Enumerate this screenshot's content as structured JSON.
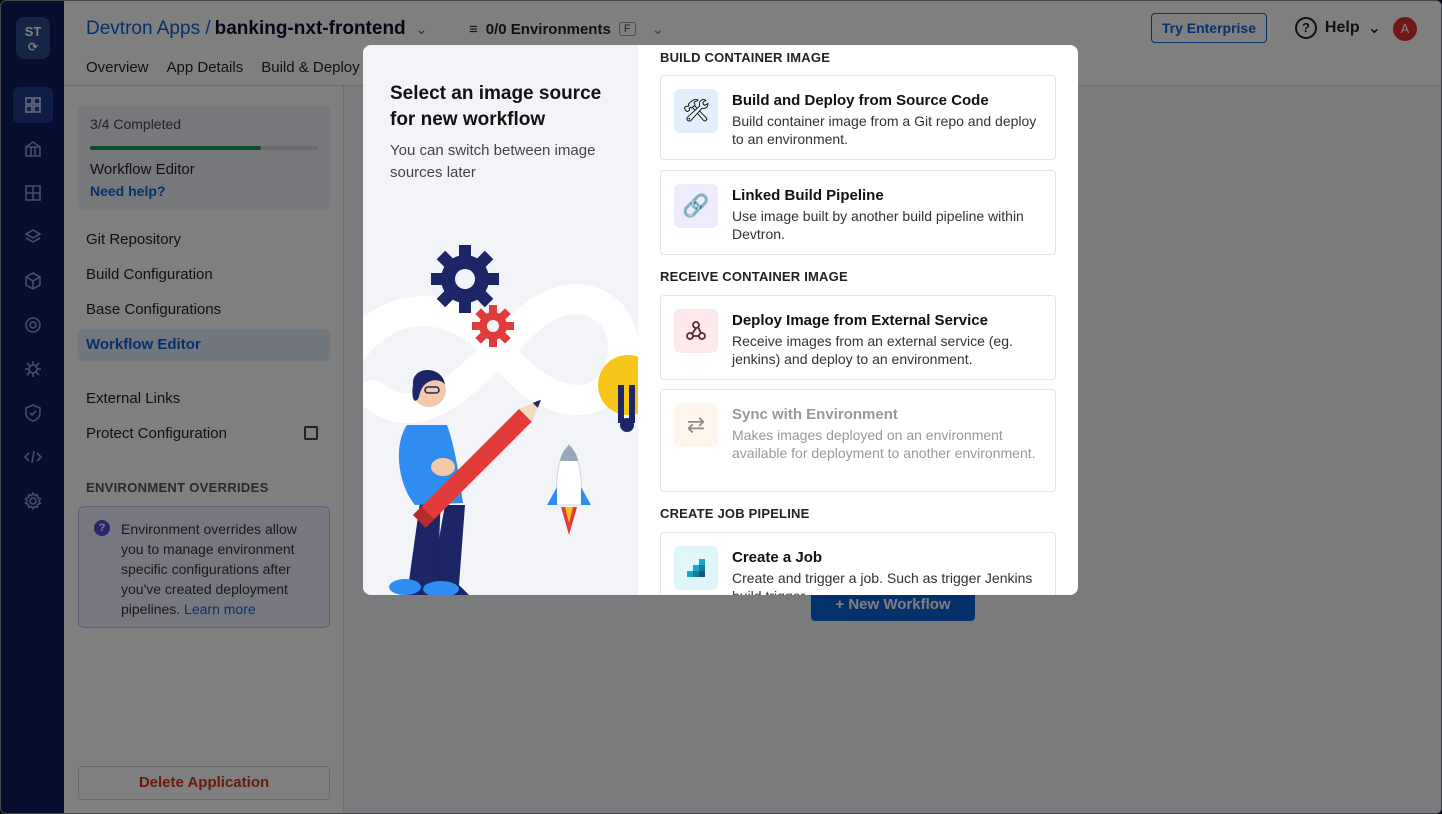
{
  "app": {
    "logo_text": "ST",
    "breadcrumb": {
      "root": "Devtron Apps /",
      "app": "banking-nxt-frontend"
    },
    "environments": {
      "label": "0/0 Environments",
      "badge": "F"
    },
    "tabs": [
      "Overview",
      "App Details",
      "Build & Deploy"
    ],
    "try_enterprise": "Try Enterprise",
    "help": "Help",
    "avatar": "A"
  },
  "sidebar": {
    "progress": {
      "label": "3/4 Completed",
      "fraction": 0.75,
      "current": "Workflow Editor",
      "help_link": "Need help?"
    },
    "items": [
      "Git Repository",
      "Build Configuration",
      "Base Configurations",
      "Workflow Editor"
    ],
    "extras": [
      "External Links",
      "Protect Configuration"
    ],
    "env_overrides_heading": "ENVIRONMENT OVERRIDES",
    "env_overrides_text": "Environment overrides allow you to manage environment specific configurations after you've created deployment pipelines.",
    "learn_more": "Learn more",
    "delete": "Delete Application"
  },
  "main": {
    "new_workflow": "+ New Workflow"
  },
  "modal": {
    "title": "Select an image source for new workflow",
    "subtitle": "You can switch between image sources later",
    "sections": [
      {
        "heading": "BUILD CONTAINER IMAGE",
        "options": [
          {
            "name": "Build and Deploy from Source Code",
            "desc": "Build container image from a Git repo and deploy to an environment.",
            "icon": "hammer-wrench-icon"
          },
          {
            "name": "Linked Build Pipeline",
            "desc": "Use image built by another build pipeline within Devtron.",
            "icon": "linked-tools-icon"
          }
        ]
      },
      {
        "heading": "RECEIVE CONTAINER IMAGE",
        "options": [
          {
            "name": "Deploy Image from External Service",
            "desc": "Receive images from an external service (eg. jenkins) and deploy to an environment.",
            "icon": "webhook-icon"
          },
          {
            "name": "Sync with Environment",
            "desc": "Makes images deployed on an environment available for deployment to another environment.",
            "icon": "sync-icon",
            "disabled": true
          }
        ]
      },
      {
        "heading": "CREATE JOB PIPELINE",
        "options": [
          {
            "name": "Create a Job",
            "desc": "Create and trigger a job. Such as trigger Jenkins build trigger",
            "icon": "job-icon"
          }
        ]
      }
    ]
  }
}
